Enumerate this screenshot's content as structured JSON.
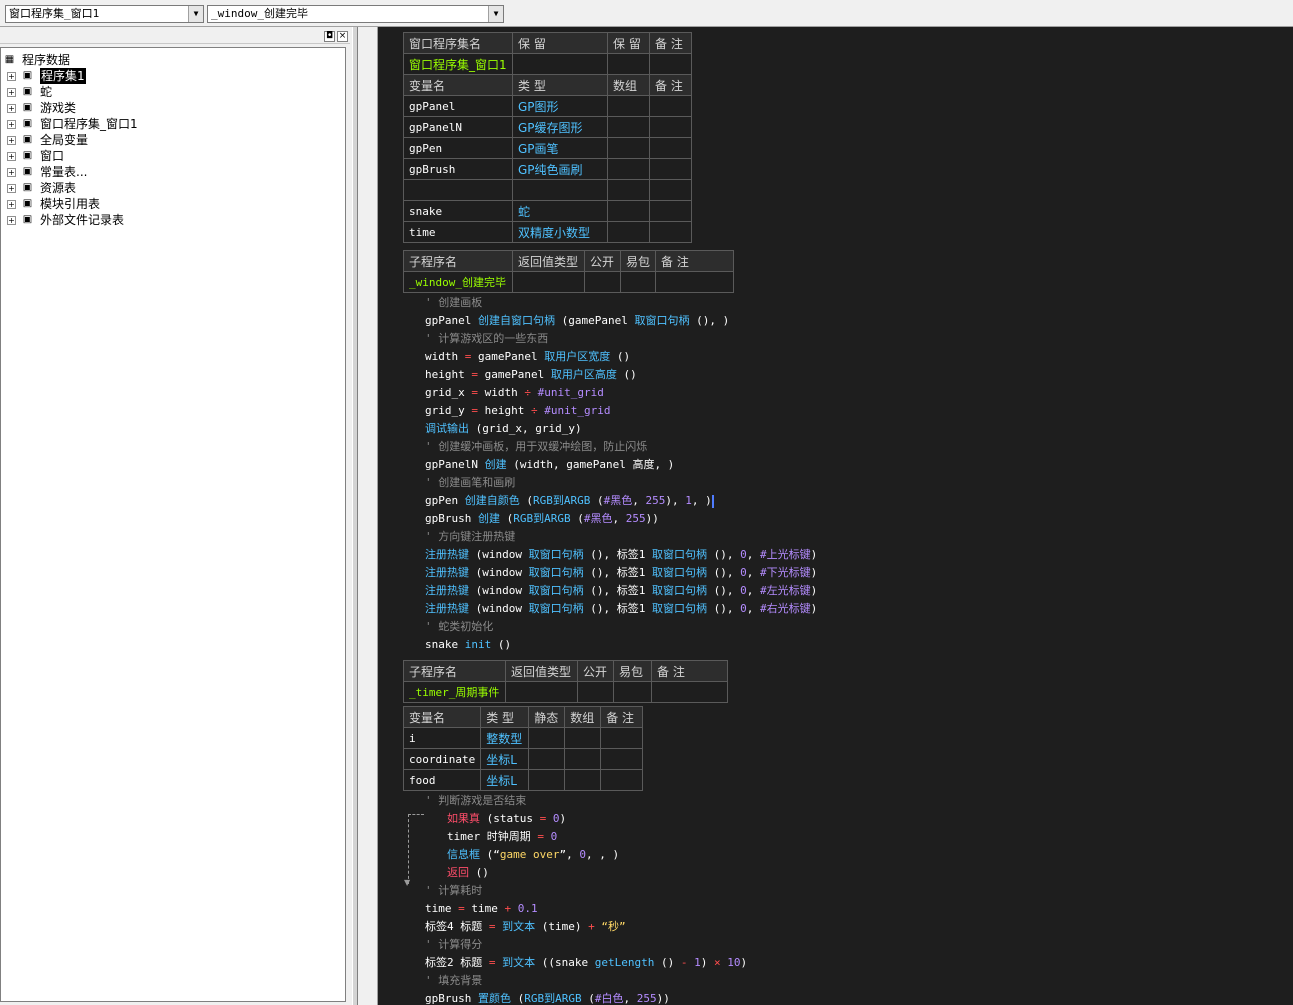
{
  "toolbar": {
    "combo1": "窗口程序集_窗口1",
    "combo2": "_window_创建完毕"
  },
  "tree": {
    "root": "程序数据",
    "items": [
      {
        "label": "程序集1",
        "icon": "assembly-icon",
        "selected": true
      },
      {
        "label": "蛇",
        "icon": "class-icon"
      },
      {
        "label": "游戏类",
        "icon": "class-icon"
      },
      {
        "label": "窗口程序集_窗口1",
        "icon": "assembly-icon"
      },
      {
        "label": "全局变量",
        "icon": "global-var-icon"
      },
      {
        "label": "窗口",
        "icon": "window-icon"
      },
      {
        "label": "常量表...",
        "icon": "constant-icon"
      },
      {
        "label": "资源表",
        "icon": "resource-icon"
      },
      {
        "label": "模块引用表",
        "icon": "module-icon"
      },
      {
        "label": "外部文件记录表",
        "icon": "file-icon"
      }
    ]
  },
  "assembly_table": {
    "headers": [
      "窗口程序集名",
      "保 留",
      "保 留",
      "备 注"
    ],
    "name": "窗口程序集_窗口1",
    "var_headers": [
      "变量名",
      "类 型",
      "数组",
      "备 注"
    ],
    "vars": [
      {
        "name": "gpPanel",
        "type": "GP图形"
      },
      {
        "name": "gpPanelN",
        "type": "GP缓存图形"
      },
      {
        "name": "gpPen",
        "type": "GP画笔"
      },
      {
        "name": "gpBrush",
        "type": "GP纯色画刷"
      },
      {
        "name": "",
        "type": ""
      },
      {
        "name": "snake",
        "type": "蛇"
      },
      {
        "name": "time",
        "type": "双精度小数型"
      }
    ]
  },
  "sub1_table": {
    "headers": [
      "子程序名",
      "返回值类型",
      "公开",
      "易包",
      "备 注"
    ],
    "name": "_window_创建完毕"
  },
  "sub2_table": {
    "headers": [
      "子程序名",
      "返回值类型",
      "公开",
      "易包",
      "备 注"
    ],
    "name": "_timer_周期事件",
    "var_headers": [
      "变量名",
      "类 型",
      "静态",
      "数组",
      "备 注"
    ],
    "vars": [
      {
        "name": "i",
        "type": "整数型"
      },
      {
        "name": "coordinate",
        "type": "坐标L"
      },
      {
        "name": "food",
        "type": "坐标L"
      }
    ]
  },
  "code": {
    "c1": "' 创建画板",
    "l1": [
      "gpPanel ",
      "创建自窗口句柄",
      " (gamePanel ",
      "取窗口句柄",
      " (), )"
    ],
    "c2": "' 计算游戏区的一些东西",
    "l2": [
      "width ",
      "=",
      " gamePanel ",
      "取用户区宽度",
      " ()"
    ],
    "l3": [
      "height ",
      "=",
      " gamePanel ",
      "取用户区高度",
      " ()"
    ],
    "l4": [
      "grid_x ",
      "=",
      " width ",
      "÷",
      " ",
      "#unit_grid"
    ],
    "l5": [
      "grid_y ",
      "=",
      " height ",
      "÷",
      " ",
      "#unit_grid"
    ],
    "l6": [
      "调试输出",
      " (grid_x, grid_y)"
    ],
    "c3": "' 创建缓冲画板，用于双缓冲绘图，防止闪烁",
    "l7": [
      "gpPanelN ",
      "创建",
      " (width, gamePanel 高度, )"
    ],
    "c4": "' 创建画笔和画刷",
    "l8": [
      "gpPen ",
      "创建自颜色",
      " (",
      "RGB到ARGB",
      " (",
      "#黑色",
      ", ",
      "255",
      "), ",
      "1",
      ", )"
    ],
    "l9": [
      "gpBrush ",
      "创建",
      " (",
      "RGB到ARGB",
      " (",
      "#黑色",
      ", ",
      "255",
      "))"
    ],
    "c5": "' 方向键注册热键",
    "hk": [
      [
        "注册热键",
        " (window ",
        "取窗口句柄",
        " (), 标签1 ",
        "取窗口句柄",
        " (), ",
        "0",
        ", ",
        "#上光标键",
        ")"
      ],
      [
        "注册热键",
        " (window ",
        "取窗口句柄",
        " (), 标签1 ",
        "取窗口句柄",
        " (), ",
        "0",
        ", ",
        "#下光标键",
        ")"
      ],
      [
        "注册热键",
        " (window ",
        "取窗口句柄",
        " (), 标签1 ",
        "取窗口句柄",
        " (), ",
        "0",
        ", ",
        "#左光标键",
        ")"
      ],
      [
        "注册热键",
        " (window ",
        "取窗口句柄",
        " (), 标签1 ",
        "取窗口句柄",
        " (), ",
        "0",
        ", ",
        "#右光标键",
        ")"
      ]
    ],
    "c6": "' 蛇类初始化",
    "l10": [
      "snake ",
      "init",
      " ()"
    ],
    "c7": "' 判断游戏是否结束",
    "l11": [
      "如果真",
      " (status ",
      "=",
      " ",
      "0",
      ")"
    ],
    "l12": [
      "timer 时钟周期 ",
      "=",
      " ",
      "0"
    ],
    "l13": [
      "信息框",
      " (“",
      "game over",
      "”, ",
      "0",
      ", , )"
    ],
    "l14": [
      "返回",
      " ()"
    ],
    "c8": "' 计算耗时",
    "l15": [
      "time ",
      "=",
      " time ",
      "+",
      " ",
      "0.1"
    ],
    "l16": [
      "标签4 标题 ",
      "=",
      " ",
      "到文本",
      " (time) ",
      "+",
      " “秒”"
    ],
    "c9": "' 计算得分",
    "l17": [
      "标签2 标题 ",
      "=",
      " ",
      "到文本",
      " ((snake ",
      "getLength",
      " () ",
      "-",
      " ",
      "1",
      ") ",
      "×",
      " ",
      "10",
      ")"
    ],
    "c10": "' 填充背景",
    "l18": [
      "gpBrush ",
      "置颜色",
      " (",
      "RGB到ARGB",
      " (",
      "#白色",
      ", ",
      "255",
      "))"
    ]
  }
}
